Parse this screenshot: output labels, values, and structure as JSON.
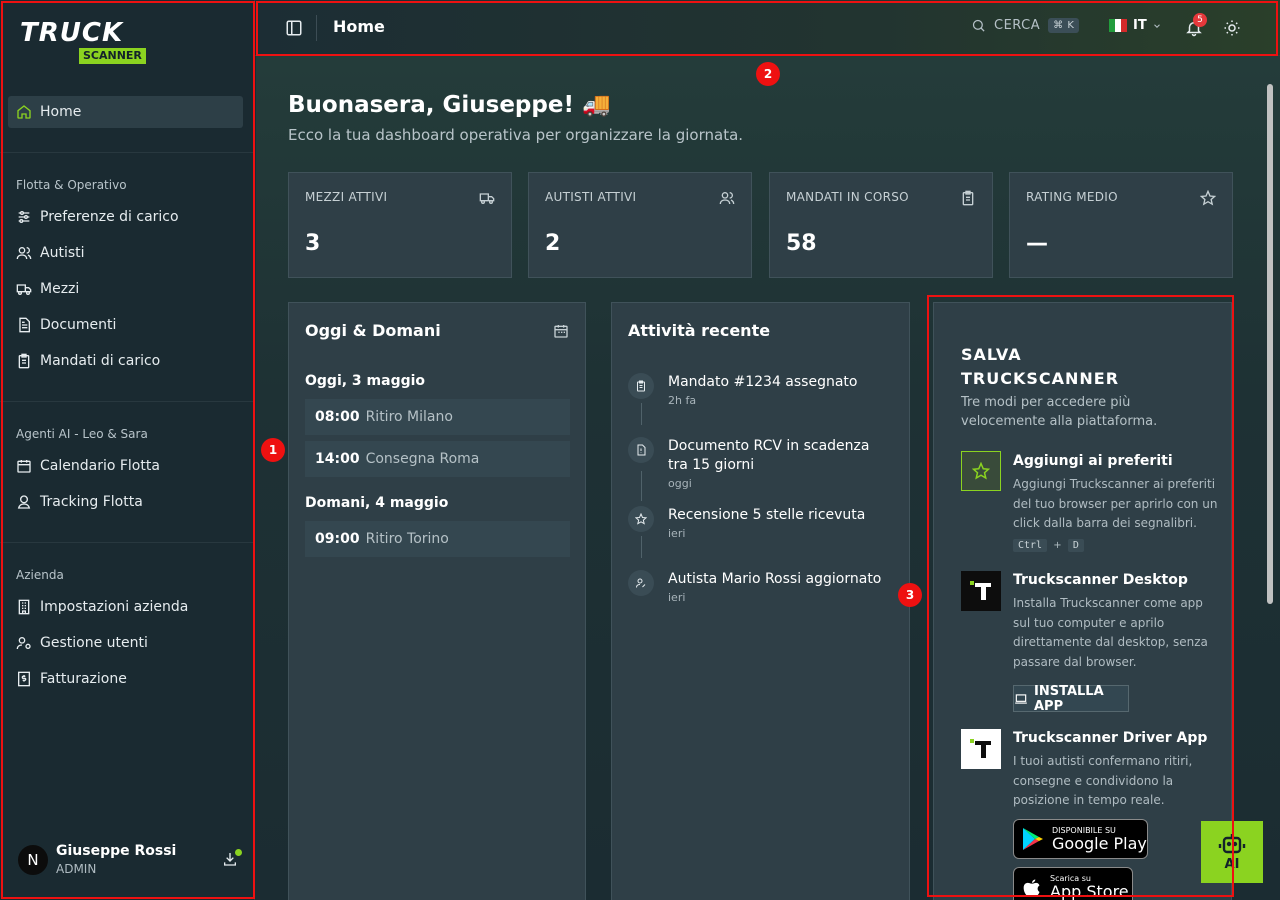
{
  "sidebar": {
    "brand": {
      "main": "TRUCK",
      "sub": "SCANNER"
    },
    "home": "Home",
    "sections": [
      {
        "title": "Flotta & Operativo",
        "items": [
          "Preferenze di carico",
          "Autisti",
          "Mezzi",
          "Documenti",
          "Mandati di carico"
        ]
      },
      {
        "title": "Agenti AI - Leo & Sara",
        "items": [
          "Calendario Flotta",
          "Tracking Flotta"
        ]
      },
      {
        "title": "Azienda",
        "items": [
          "Impostazioni azienda",
          "Gestione utenti",
          "Fatturazione"
        ]
      }
    ],
    "user": {
      "initial": "N",
      "name": "Giuseppe Rossi",
      "role": "ADMIN"
    }
  },
  "topbar": {
    "title": "Home",
    "search_label": "CERCA",
    "search_kbd": "⌘ K",
    "lang": "IT",
    "notifications": "5"
  },
  "main": {
    "greeting": "Buonasera, Giuseppe! 🚚",
    "subtitle": "Ecco la tua dashboard operativa per organizzare la giornata.",
    "stats": [
      {
        "label": "MEZZI ATTIVI",
        "value": "3"
      },
      {
        "label": "AUTISTI ATTIVI",
        "value": "2"
      },
      {
        "label": "MANDATI IN CORSO",
        "value": "58"
      },
      {
        "label": "RATING MEDIO",
        "value": "—"
      }
    ],
    "schedule": {
      "title": "Oggi & Domani",
      "today": "Oggi, 3 maggio",
      "today_events": [
        {
          "time": "08:00",
          "desc": "Ritiro Milano"
        },
        {
          "time": "14:00",
          "desc": "Consegna Roma"
        }
      ],
      "tomorrow": "Domani, 4 maggio",
      "tomorrow_events": [
        {
          "time": "09:00",
          "desc": "Ritiro Torino"
        }
      ]
    },
    "activity": {
      "title": "Attività recente",
      "items": [
        {
          "title": "Mandato #1234 assegnato",
          "time": "2h fa"
        },
        {
          "title": "Documento RCV in scadenza tra 15 giorni",
          "time": "oggi"
        },
        {
          "title": "Recensione 5 stelle ricevuta",
          "time": "ieri"
        },
        {
          "title": "Autista Mario Rossi aggiornato",
          "time": "ieri"
        }
      ]
    },
    "promo": {
      "title_l1": "SALVA",
      "title_l2": "TRUCKSCANNER",
      "subtitle": "Tre modi per accedere più velocemente alla piattaforma.",
      "options": [
        {
          "title": "Aggiungi ai preferiti",
          "desc": "Aggiungi Truckscanner ai preferiti del tuo browser per aprirlo con un click dalla barra dei segnalibri.",
          "kbd1": "Ctrl",
          "plus": "+",
          "kbd2": "D"
        },
        {
          "title": "Truckscanner Desktop",
          "desc": "Installa Truckscanner come app sul tuo computer e aprilo direttamente dal desktop, senza passare dal browser.",
          "button": "INSTALLA APP"
        },
        {
          "title": "Truckscanner Driver App",
          "desc": "I tuoi autisti confermano ritiri, consegne e condividono la posizione in tempo reale."
        }
      ],
      "google_small": "DISPONIBILE SU",
      "google_big": "Google Play",
      "apple_small": "Scarica su",
      "apple_big": "App Store"
    },
    "ai_button": "AI"
  },
  "annotations": [
    "1",
    "2",
    "3"
  ],
  "colors": {
    "accent": "#8bd320",
    "highlight": "#ee1111",
    "badge": "#e5383b"
  }
}
